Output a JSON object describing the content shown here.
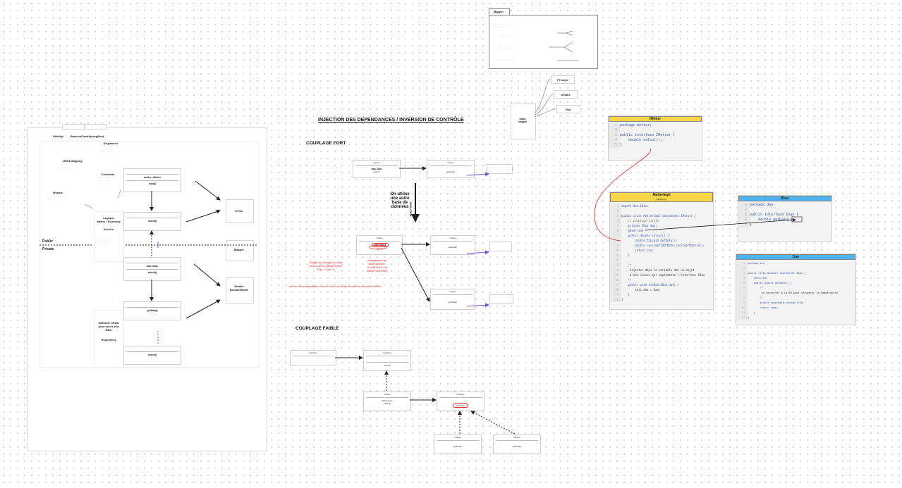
{
  "arch": {
    "tabs": [
      "WebApi",
      "BackendJavaSpringBoot"
    ],
    "jsonMapping": "JSON Mapping",
    "dispatcher": "Dispatcher",
    "controller": "Controller",
    "models": "Models",
    "logique": "Logique\nMetier / Business",
    "service": "Service",
    "methodeCrud": "Méthode CRUD\npour accès à la\nBDD",
    "repository": "Repository",
    "publicLbl": "Public",
    "privateLbl": "Private",
    "dtos": "DTOs",
    "mapper": "Mapper",
    "entites": "Entités\nDomainModel",
    "metierField": "métier: IMetier",
    "mainMethod": "main()",
    "calculMethod": "calcul()",
    "daoField": "dao: IDao",
    "getDataMethod": "getData()"
  },
  "injection": {
    "title": "INJECTION DES DEPENDANCES / INVERSION DE CONTRÔLE",
    "couplageFort": "COUPLAGE FORT",
    "couplageFaible": "COUPLAGE FAIBLE",
    "onUtilise": "On utilise\nune autre\nbase de\ndonnées",
    "evolution": "EVOLUTION",
    "obligeChanger": "Obligé de changer le code\nsource de la classe métier\nDao -> Dao 2",
    "changement": "changement du\ncode source :\nOUVERTE À LA\nMODIFICATION",
    "pasRetro": "pas de rétrocompatibilité c'est au client de choisir la base de donnée à utiliser",
    "daoDao": "dao: Dao",
    "daoDao2": "dao: Dao2",
    "calcul": "calcul()",
    "getData": "getData()",
    "interface": "Interface",
    "classe": "Classe",
    "metierImpl": "MetierImpl",
    "dao": "Dao"
  },
  "code": {
    "imetierTitle": "IMetier",
    "imetierLines": [
      "package metier;",
      "",
      "public interface IMetier {",
      "    double calcul();",
      "}"
    ],
    "metierImplTitle": "MetierImpl",
    "metierImplSub": "MetierImpl",
    "metierImplLines": [
      "import dao.IDao;",
      "",
      "public class MetierImpl implements IMetier {",
      "    // Couplage faible",
      "    private IDao dao;",
      "    @Override",
      "    public double calcul() {",
      "        double tmp=dao.getData();",
      "        double res=tmp*540*Math.cos(tmp*Math.PI);",
      "        return res;",
      "    }",
      "",
      "    /*",
      "     Injecter dans la variable dao un objet",
      "     d'une classe qui implémente l'interface IDao",
      "    */",
      "    public void setDao(IDao dao) {",
      "        this.dao = dao;",
      "    }",
      "}"
    ],
    "idaoTitle": "IDao",
    "idaoLines": [
      "package dao;",
      "",
      "public interface IDao {",
      "    double getData();",
      "}"
    ],
    "daoTitle": "Dao",
    "daoLines": [
      "package dao;",
      "",
      "public class DaoImpl implements IDao {",
      "    @Override",
      "    public double getData() {",
      "        /*",
      "         Se connecter à la BD pour récupérer la température",
      "        */",
      "        double temp=Math.random()*40;",
      "        return temp;",
      "    }",
      "}"
    ]
  },
  "mapper": {
    "title": "Mapper",
    "nodes": [
      "Principe",
      "Details",
      "Exit"
    ],
    "side": "static\nmapper"
  }
}
